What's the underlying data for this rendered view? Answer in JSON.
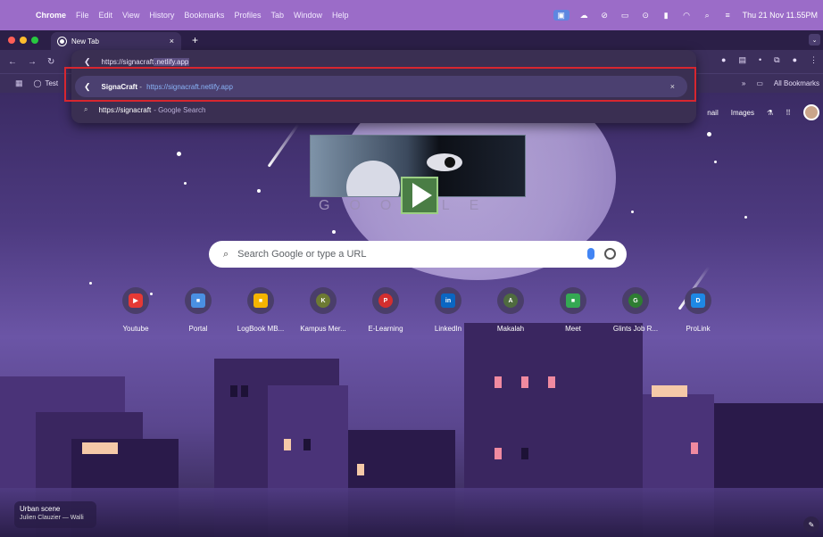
{
  "menubar": {
    "app": "Chrome",
    "items": [
      "File",
      "Edit",
      "View",
      "History",
      "Bookmarks",
      "Profiles",
      "Tab",
      "Window",
      "Help"
    ],
    "clock": "Thu 21 Nov  11.55PM"
  },
  "tab": {
    "title": "New Tab",
    "close": "×",
    "new": "+"
  },
  "bookmarks": {
    "test": "Test",
    "overflow": "»",
    "all": "All Bookmarks"
  },
  "omnibox": {
    "typed_prefix": "https://signacraft",
    "typed_suffix": ".netlify.app",
    "suggestion_name": "SignaCraft",
    "suggestion_sep": " - ",
    "suggestion_url": "https://signacraft.netlify.app",
    "search_query": "https://signacraft",
    "search_suffix": "- Google Search",
    "remove": "×"
  },
  "header_links": {
    "gmail": "nail",
    "images": "Images"
  },
  "doodle": {
    "letters": "GOOGLE"
  },
  "search": {
    "placeholder": "Search Google or type a URL"
  },
  "shortcuts": [
    {
      "label": "Youtube",
      "glyph": "▶",
      "color": "#e53935"
    },
    {
      "label": "Portal",
      "glyph": "■",
      "color": "#4a90e2"
    },
    {
      "label": "LogBook MB...",
      "glyph": "■",
      "color": "#f5b400"
    },
    {
      "label": "Kampus Mer...",
      "glyph": "K",
      "color": "#6d7a33"
    },
    {
      "label": "E-Learning",
      "glyph": "P",
      "color": "#d32f2f"
    },
    {
      "label": "LinkedIn",
      "glyph": "in",
      "color": "#0a66c2"
    },
    {
      "label": "Makalah",
      "glyph": "A",
      "color": "#4f6b3f"
    },
    {
      "label": "Meet",
      "glyph": "■",
      "color": "#34a853"
    },
    {
      "label": "Glints Job R...",
      "glyph": "G",
      "color": "#2e7d32"
    },
    {
      "label": "ProLink",
      "glyph": "D",
      "color": "#1e88e5"
    }
  ],
  "credits": {
    "title": "Urban scene",
    "author": "Julien Clauzier — Walli"
  },
  "icons": [
    "apple-icon",
    "chrome-icon",
    "close-icon",
    "plus-icon",
    "back-icon",
    "forward-icon",
    "reload-icon",
    "search-icon",
    "mic-icon",
    "lens-icon",
    "pencil-icon",
    "apps-grid-icon",
    "folder-icon",
    "lab-icon",
    "globe-icon",
    "avatar"
  ]
}
